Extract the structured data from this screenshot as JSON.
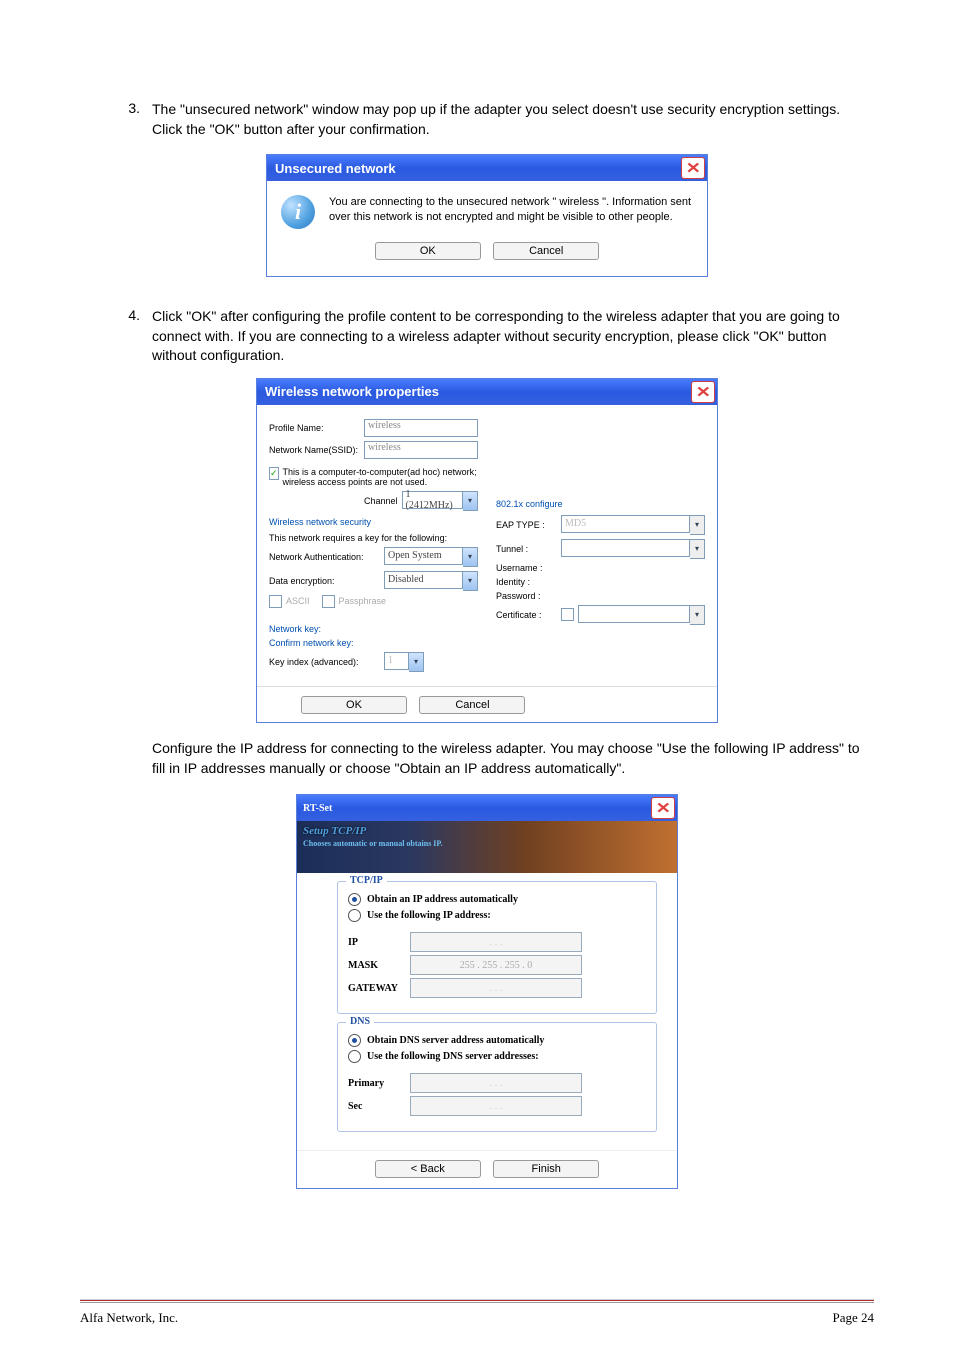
{
  "step3": {
    "num": "3.",
    "text": "The \"unsecured network\" window may pop up if the adapter you select doesn't use security encryption settings. Click the \"OK\" button after your confirmation."
  },
  "step4": {
    "num": "4.",
    "text": "Click \"OK\" after configuring the profile content to be corresponding to the wireless adapter that you are going to connect with. If you are connecting to a wireless adapter without security encryption, please click \"OK\" button without configuration."
  },
  "midtext": "Configure the IP address for connecting to the wireless adapter. You may choose \"Use the following IP address\" to fill in IP addresses manually or choose \"Obtain an IP address automatically\".",
  "dlg1": {
    "title": "Unsecured network",
    "msg": "You are connecting to the unsecured network \" wireless \". Information sent over this network is not encrypted and might be visible to other people.",
    "ok": "OK",
    "cancel": "Cancel"
  },
  "dlg2": {
    "title": "Wireless network properties",
    "profile_lbl": "Profile Name:",
    "profile_val": "wireless",
    "ssid_lbl": "Network Name(SSID):",
    "ssid_val": "wireless",
    "adhoc_lbl": "This is a computer-to-computer(ad hoc) network; wireless access points are not used.",
    "channel_lbl": "Channel",
    "channel_val": "1 (2412MHz)",
    "sec_hdr": "Wireless network security",
    "sec_req": "This network requires a key for the following:",
    "auth_lbl": "Network Authentication:",
    "auth_val": "Open System",
    "enc_lbl": "Data encryption:",
    "enc_val": "Disabled",
    "ascii": "ASCII",
    "pass": "Passphrase",
    "key_lbl": "Network key:",
    "confkey_lbl": "Confirm network key:",
    "keyidx_lbl": "Key index (advanced):",
    "keyidx_val": "1",
    "cfg_hdr": "802.1x configure",
    "eap_lbl": "EAP TYPE :",
    "eap_val": "MD5",
    "tunnel_lbl": "Tunnel :",
    "user_lbl": "Username :",
    "ident_lbl": "Identity :",
    "pw_lbl": "Password :",
    "cert_lbl": "Certificate :",
    "ok": "OK",
    "cancel": "Cancel"
  },
  "dlg3": {
    "title": "RT-Set",
    "hero_h1": "Setup TCP/IP",
    "hero_h2": "Chooses automatic or manual obtains IP.",
    "tcpip": "TCP/IP",
    "obtain_ip": "Obtain an IP address automatically",
    "use_ip": "Use the following IP address:",
    "ip_lbl": "IP",
    "mask_lbl": "MASK",
    "mask_val": "255  .  255  .  255  .    0",
    "gw_lbl": "GATEWAY",
    "dns": "DNS",
    "obtain_dns": "Obtain DNS server address automatically",
    "use_dns": "Use the following DNS server addresses:",
    "primary": "Primary",
    "sec": "Sec",
    "back": "< Back",
    "finish": "Finish",
    "dots": ".           .           ."
  },
  "footer": {
    "left": "Alfa Network, Inc.",
    "right": "Page 24"
  }
}
